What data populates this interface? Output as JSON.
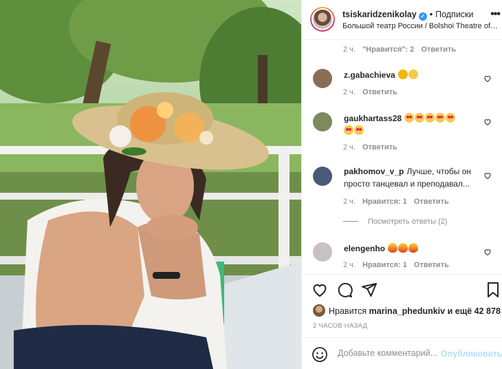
{
  "post": {
    "owner": "tsiskaridzenikolay",
    "verified_mark": "✓",
    "separator": "•",
    "follow_label": "Подписки",
    "location": "Большой театр России / Bolshoi Theatre of R...",
    "more_label": "•••"
  },
  "top_meta": {
    "time": "2 ч.",
    "likes": "\"Нравится\": 2",
    "reply": "Ответить"
  },
  "comments": [
    {
      "user": "z.gabachieva",
      "emojis": [
        "clap",
        "laugh"
      ],
      "time": "2 ч.",
      "reply": "Ответить",
      "avatar_color": "#8a6d55"
    },
    {
      "user": "gaukhartass28",
      "emojis": [
        "heart-eyes",
        "heart-eyes",
        "heart-eyes",
        "heart-eyes",
        "heart-eyes",
        "heart-eyes",
        "heart-eyes"
      ],
      "time": "2 ч.",
      "reply": "Ответить",
      "avatar_color": "#7c8a5e"
    },
    {
      "user": "pakhomov_v_p",
      "text_line1": "Лучше, чтобы он",
      "text_line2": "просто танцевал и преподавал...",
      "time": "2 ч.",
      "likes": "Нравится: 1",
      "reply": "Ответить",
      "view_replies": "Посмотреть ответы (2)",
      "avatar_color": "#4a5a78"
    },
    {
      "user": "elengenho",
      "emojis": [
        "fire",
        "fire",
        "fire"
      ],
      "time": "2 ч.",
      "likes": "Нравится: 1",
      "reply": "Ответить",
      "avatar_color": "#c9c0c6"
    }
  ],
  "likes_line": {
    "prefix": "Нравится",
    "user": "marina_phedunkiv",
    "suffix": "и ещё 42 878"
  },
  "time_ago": "2 ЧАСОВ НАЗАД",
  "add_comment": {
    "placeholder": "Добавьте комментарий...",
    "publish": "Опубликовать"
  },
  "icons": {
    "like": "heart-icon",
    "comment": "comment-icon",
    "share": "paper-plane-icon",
    "save": "bookmark-icon",
    "emoji": "smile-icon"
  }
}
